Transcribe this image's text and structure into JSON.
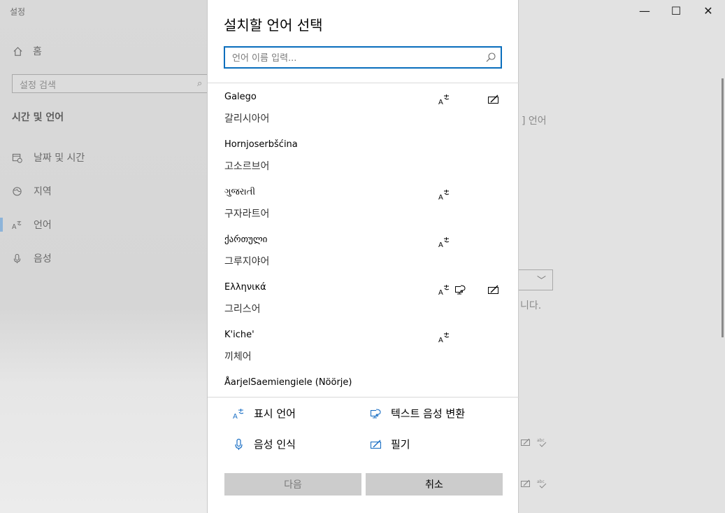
{
  "window": {
    "title": "설정",
    "minimize_glyph": "—",
    "maximize_glyph": "☐",
    "close_glyph": "✕"
  },
  "sidebar": {
    "home_label": "홈",
    "search_placeholder": "설정 검색",
    "section_title": "시간 및 언어",
    "items": [
      {
        "label": "날짜 및 시간",
        "icon": "calendar-clock-icon"
      },
      {
        "label": "지역",
        "icon": "globe-icon"
      },
      {
        "label": "언어",
        "icon": "language-icon"
      },
      {
        "label": "음성",
        "icon": "microphone-icon"
      }
    ]
  },
  "background": {
    "text_1": "] 언어",
    "text_2": "니다."
  },
  "dialog": {
    "title": "설치할 언어 선택",
    "search_placeholder": "언어 이름 입력...",
    "languages": [
      {
        "native": "Galego",
        "korean": "갈리시아어",
        "features": [
          "display",
          "handwriting"
        ]
      },
      {
        "native": "Hornjoserbšćina",
        "korean": "고소르브어",
        "features": []
      },
      {
        "native": "ગુજરાતી",
        "korean": "구자라트어",
        "features": [
          "display"
        ]
      },
      {
        "native": "ქართული",
        "korean": "그루지야어",
        "features": [
          "display"
        ]
      },
      {
        "native": "Ελληνικά",
        "korean": "그리스어",
        "features": [
          "display",
          "tts",
          "handwriting"
        ]
      },
      {
        "native": "K'iche'",
        "korean": "끼체어",
        "features": [
          "display"
        ]
      },
      {
        "native": "ÅarjelSaemiengiele (Nöörje)",
        "korean": "",
        "features": []
      }
    ],
    "legend": {
      "display_language": "표시 언어",
      "text_to_speech": "텍스트 음성 변환",
      "speech_recognition": "음성 인식",
      "handwriting": "필기"
    },
    "buttons": {
      "next": "다음",
      "cancel": "취소"
    }
  },
  "colors": {
    "accent": "#0a6ebd",
    "icon_blue": "#1a6fc4"
  }
}
